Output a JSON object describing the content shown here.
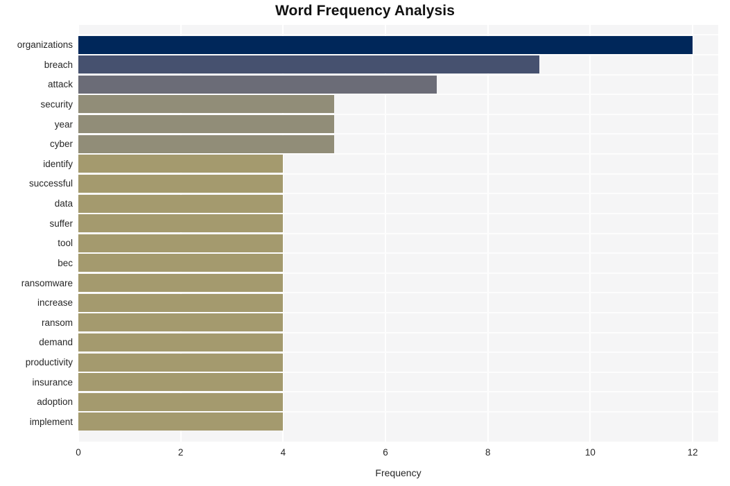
{
  "chart_data": {
    "type": "bar",
    "orientation": "horizontal",
    "title": "Word Frequency Analysis",
    "xlabel": "Frequency",
    "ylabel": "",
    "xlim": [
      0,
      12.5
    ],
    "xticks": [
      0,
      2,
      4,
      6,
      8,
      10,
      12
    ],
    "xticklabels": [
      "0",
      "2",
      "4",
      "6",
      "8",
      "10",
      "12"
    ],
    "grid": true,
    "grid_axis": "both",
    "legend": "none",
    "categories": [
      "organizations",
      "breach",
      "attack",
      "security",
      "year",
      "cyber",
      "identify",
      "successful",
      "data",
      "suffer",
      "tool",
      "bec",
      "ransomware",
      "increase",
      "ransom",
      "demand",
      "productivity",
      "insurance",
      "adoption",
      "implement"
    ],
    "values": [
      12,
      9,
      7,
      5,
      5,
      5,
      4,
      4,
      4,
      4,
      4,
      4,
      4,
      4,
      4,
      4,
      4,
      4,
      4,
      4
    ],
    "bar_colors": [
      "#00275a",
      "#46516f",
      "#6b6c77",
      "#918d78",
      "#918d78",
      "#918d78",
      "#a49a6e",
      "#a49a6e",
      "#a49a6e",
      "#a49a6e",
      "#a49a6e",
      "#a49a6e",
      "#a49a6e",
      "#a49a6e",
      "#a49a6e",
      "#a49a6e",
      "#a49a6e",
      "#a49a6e",
      "#a49a6e",
      "#a49a6e"
    ],
    "plot_background": "#f5f5f6",
    "grid_color": "#ffffff",
    "text_color": "#262626"
  }
}
